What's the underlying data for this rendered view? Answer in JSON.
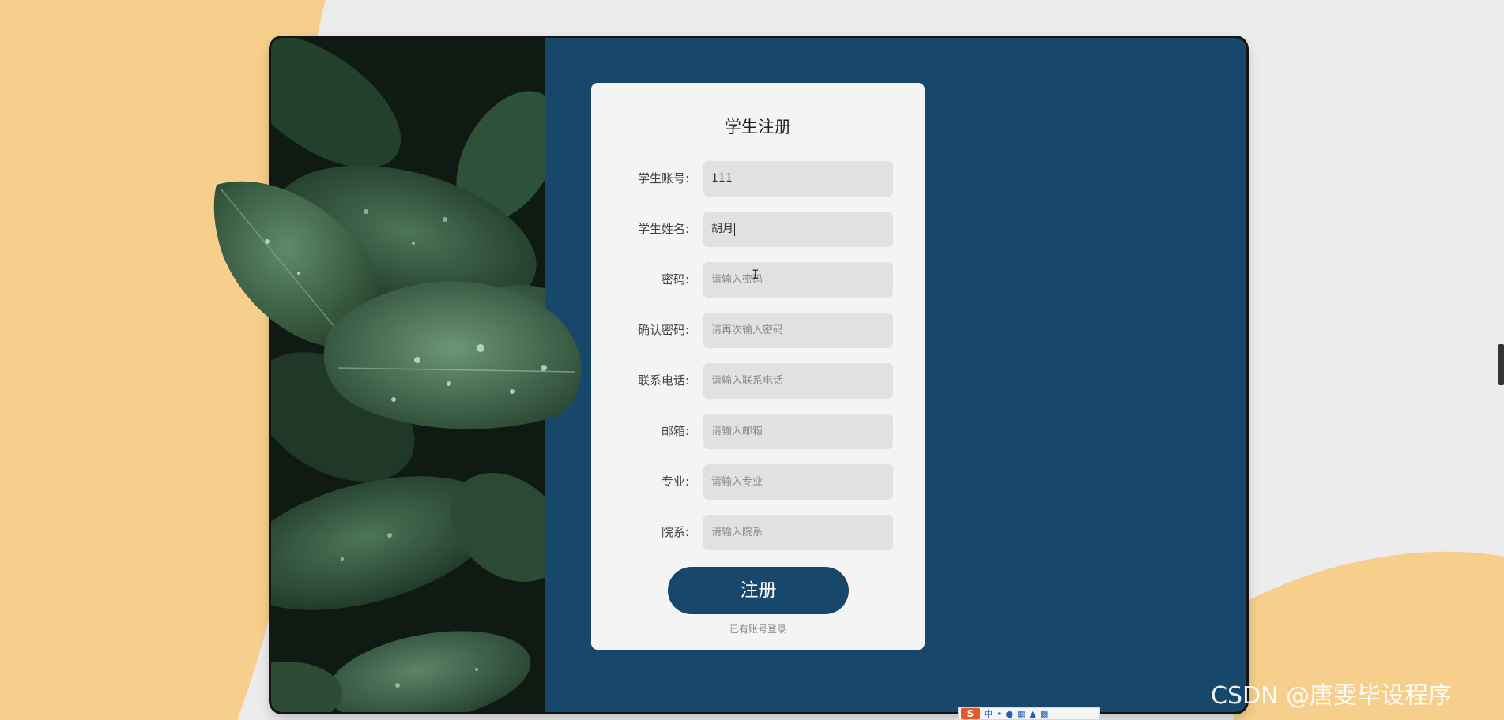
{
  "card": {
    "title": "学生注册",
    "fields": [
      {
        "label": "学生账号:",
        "value": "111",
        "placeholder": ""
      },
      {
        "label": "学生姓名:",
        "value": "胡月",
        "placeholder": ""
      },
      {
        "label": "密码:",
        "value": "",
        "placeholder": "请输入密码"
      },
      {
        "label": "确认密码:",
        "value": "",
        "placeholder": "请再次输入密码"
      },
      {
        "label": "联系电话:",
        "value": "",
        "placeholder": "请输入联系电话"
      },
      {
        "label": "邮箱:",
        "value": "",
        "placeholder": "请输入邮箱"
      },
      {
        "label": "专业:",
        "value": "",
        "placeholder": "请输入专业"
      },
      {
        "label": "院系:",
        "value": "",
        "placeholder": "请输入院系"
      }
    ],
    "register_label": "注册",
    "login_link": "已有账号登录"
  },
  "ime": {
    "logo": "S",
    "mode": "中"
  },
  "watermark": "CSDN @唐雯毕设程序",
  "colors": {
    "page_bg": "#ececec",
    "accent_bg": "#f6cf8c",
    "panel": "#17476a",
    "card": "#f4f4f4",
    "input": "#e1e1e1"
  }
}
